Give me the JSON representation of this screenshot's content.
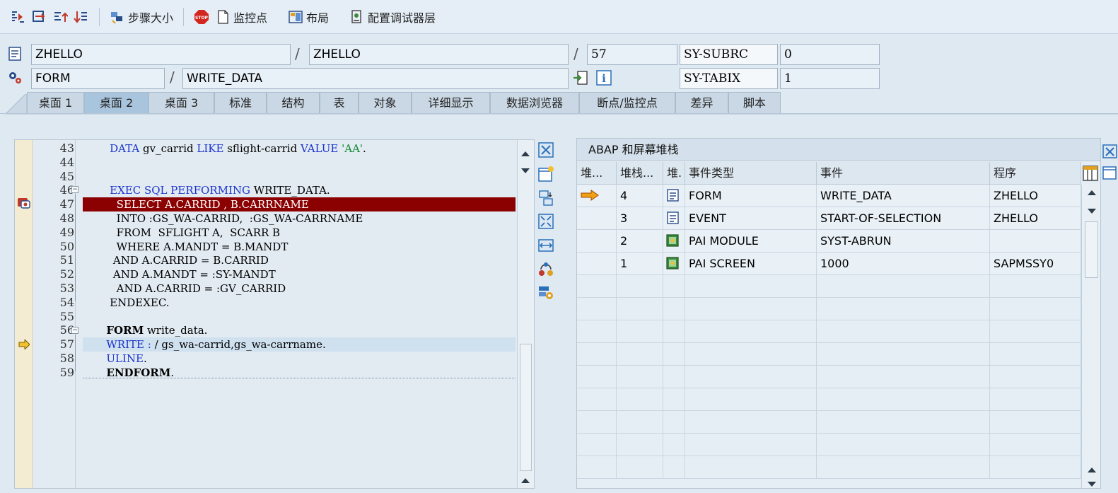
{
  "toolbar": {
    "icons": [
      "step-into-icon",
      "step-over-icon",
      "step-return-icon",
      "continue-icon",
      "step-size-icon",
      "stop-icon",
      "watchpoint-icon",
      "layout-icon",
      "config-layers-icon"
    ],
    "step_size_label": "步骤大小",
    "watchpoint_label": "监控点",
    "layout_label": "布局",
    "config_label": "配置调试器层"
  },
  "context": {
    "program_1": "ZHELLO",
    "program_2": "ZHELLO",
    "line": "57",
    "sy_subrc_label": "SY-SUBRC",
    "sy_subrc_value": "0",
    "event_type": "FORM",
    "event_name": "WRITE_DATA",
    "sy_tabix_label": "SY-TABIX",
    "sy_tabix_value": "1",
    "separator": "/"
  },
  "tabs": [
    {
      "label": "桌面 1"
    },
    {
      "label": "桌面 2"
    },
    {
      "label": "桌面 3"
    },
    {
      "label": "标准"
    },
    {
      "label": "结构"
    },
    {
      "label": "表"
    },
    {
      "label": "对象"
    },
    {
      "label": "详细显示"
    },
    {
      "label": "数据浏览器"
    },
    {
      "label": "断点/监控点"
    },
    {
      "label": "差异"
    },
    {
      "label": "脚本"
    }
  ],
  "active_tab": "桌面 2",
  "source": {
    "lines": [
      {
        "no": "43",
        "parts": [
          [
            "        ",
            ""
          ],
          [
            "DATA",
            "kw"
          ],
          [
            " gv_carrid ",
            ""
          ],
          [
            "LIKE",
            "kw"
          ],
          [
            " sflight-carrid ",
            ""
          ],
          [
            "VALUE",
            "kw"
          ],
          [
            " ",
            ""
          ],
          [
            "'AA'",
            "str"
          ],
          [
            ".",
            ""
          ]
        ]
      },
      {
        "no": "44",
        "parts": []
      },
      {
        "no": "45",
        "parts": []
      },
      {
        "no": "46",
        "parts": [
          [
            "        ",
            ""
          ],
          [
            "EXEC SQL PERFORMING",
            "kw"
          ],
          [
            " WRITE_DATA.",
            ""
          ]
        ]
      },
      {
        "no": "47",
        "parts": [
          [
            "          SELECT A.CARRID , B.CARRNAME",
            ""
          ]
        ]
      },
      {
        "no": "48",
        "parts": [
          [
            "          INTO :GS_WA-CARRID,  :GS_WA-CARRNAME",
            ""
          ]
        ]
      },
      {
        "no": "49",
        "parts": [
          [
            "          FROM  SFLIGHT A,  SCARR B",
            ""
          ]
        ]
      },
      {
        "no": "50",
        "parts": [
          [
            "          WHERE A.MANDT = B.MANDT",
            ""
          ]
        ]
      },
      {
        "no": "51",
        "parts": [
          [
            "         AND A.CARRID = B.CARRID",
            ""
          ]
        ]
      },
      {
        "no": "52",
        "parts": [
          [
            "         AND A.MANDT = :SY-MANDT",
            ""
          ]
        ]
      },
      {
        "no": "53",
        "parts": [
          [
            "          AND A.CARRID = :GV_CARRID",
            ""
          ]
        ]
      },
      {
        "no": "54",
        "parts": [
          [
            "        ENDEXEC.",
            ""
          ]
        ]
      },
      {
        "no": "55",
        "parts": []
      },
      {
        "no": "56",
        "parts": [
          [
            "       ",
            ""
          ],
          [
            "FORM",
            "bold"
          ],
          [
            " write_data.",
            ""
          ]
        ]
      },
      {
        "no": "57",
        "parts": [
          [
            "       ",
            ""
          ],
          [
            "WRITE",
            "kw"
          ],
          [
            " ",
            ""
          ],
          [
            ":",
            "kw"
          ],
          [
            " / gs_wa-carrid,gs_wa-carrname.",
            ""
          ]
        ]
      },
      {
        "no": "58",
        "parts": [
          [
            "       ",
            ""
          ],
          [
            "ULINE",
            "kw"
          ],
          [
            ".",
            ""
          ]
        ]
      },
      {
        "no": "59",
        "parts": [
          [
            "       ",
            ""
          ],
          [
            "ENDFORM",
            "bold"
          ],
          [
            ".",
            ""
          ]
        ]
      }
    ],
    "breakpoint_line": "47",
    "current_line": "57"
  },
  "stack": {
    "title": "ABAP 和屏幕堆栈",
    "columns": [
      "堆...",
      "堆栈...",
      "堆.",
      "事件类型",
      "事件",
      "程序"
    ],
    "rows": [
      {
        "active": true,
        "level": "4",
        "type": "FORM",
        "event": "WRITE_DATA",
        "program": "ZHELLO",
        "type_icon": "form-icon"
      },
      {
        "active": false,
        "level": "3",
        "type": "EVENT",
        "event": "START-OF-SELECTION",
        "program": "ZHELLO",
        "type_icon": "form-icon"
      },
      {
        "active": false,
        "level": "2",
        "type": "PAI MODULE",
        "event": "SYST-ABRUN",
        "program": "",
        "type_icon": "screen-icon"
      },
      {
        "active": false,
        "level": "1",
        "type": "PAI SCREEN",
        "event": "1000",
        "program": "SAPMSSY0",
        "type_icon": "screen-icon"
      }
    ]
  },
  "colors": {
    "breakpoint_highlight": "#8b0000",
    "keyword": "#1a33cc",
    "string": "#118a32"
  }
}
